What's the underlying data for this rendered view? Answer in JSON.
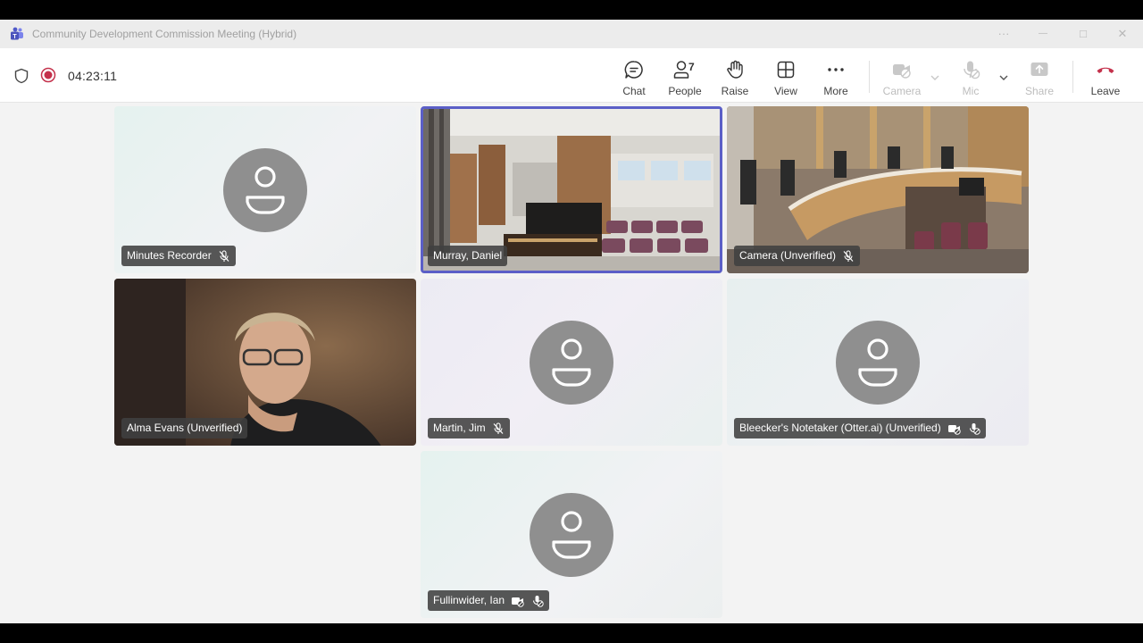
{
  "window": {
    "title": "Community Development Commission Meeting (Hybrid)",
    "controls": {
      "more": "···",
      "minimize": "—",
      "maximize": "□",
      "close": "✕"
    }
  },
  "toolbar": {
    "recording_time": "04:23:11",
    "chat_label": "Chat",
    "people_label": "People",
    "people_count": "7",
    "raise_label": "Raise",
    "view_label": "View",
    "more_label": "More",
    "camera_label": "Camera",
    "mic_label": "Mic",
    "share_label": "Share",
    "leave_label": "Leave"
  },
  "participants": [
    {
      "name": "Minutes Recorder",
      "video": false,
      "mic_muted": true
    },
    {
      "name": "Murray, Daniel",
      "video": true,
      "active_speaker": true
    },
    {
      "name": "Camera (Unverified)",
      "video": true,
      "mic_muted": true
    },
    {
      "name": "Alma Evans (Unverified)",
      "video": true
    },
    {
      "name": "Martin, Jim",
      "video": false,
      "mic_muted": true
    },
    {
      "name": "Bleecker's Notetaker (Otter.ai) (Unverified)",
      "video": false,
      "camera_disabled": true,
      "mic_disabled": true
    },
    {
      "name": "Fullinwider, Ian",
      "video": false,
      "camera_disabled": true,
      "mic_disabled": true
    }
  ],
  "colors": {
    "accent": "#5b5fc7",
    "record": "#c4314b",
    "leave": "#c4314b"
  }
}
